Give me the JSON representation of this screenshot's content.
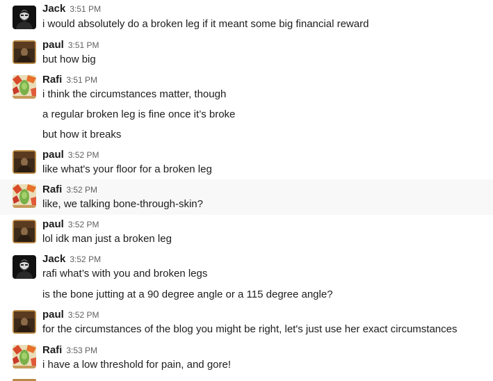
{
  "messages": [
    {
      "author": "Jack",
      "avatar": "jack",
      "time": "3:51 PM",
      "lines": [
        "i would absolutely do a broken leg if it meant some big financial reward"
      ]
    },
    {
      "author": "paul",
      "avatar": "paul",
      "time": "3:51 PM",
      "lines": [
        "but how big"
      ]
    },
    {
      "author": "Rafi",
      "avatar": "rafi",
      "time": "3:51 PM",
      "lines": [
        "i think the circumstances matter, though",
        "a regular broken leg is fine once it’s broke",
        "but how it breaks"
      ]
    },
    {
      "author": "paul",
      "avatar": "paul",
      "time": "3:52 PM",
      "lines": [
        "like what's your floor for a broken leg"
      ]
    },
    {
      "author": "Rafi",
      "avatar": "rafi",
      "time": "3:52 PM",
      "lines": [
        "like, we talking bone-through-skin?"
      ]
    },
    {
      "author": "paul",
      "avatar": "paul",
      "time": "3:52 PM",
      "lines": [
        "lol idk man just a broken leg"
      ]
    },
    {
      "author": "Jack",
      "avatar": "jack",
      "time": "3:52 PM",
      "lines": [
        "rafi what’s with you and broken legs",
        "is the bone jutting at a 90 degree angle or a 115 degree angle?"
      ]
    },
    {
      "author": "paul",
      "avatar": "paul",
      "time": "3:52 PM",
      "lines": [
        "for the circumstances of the blog you might be right, let's just use her exact circumstances"
      ]
    },
    {
      "author": "Rafi",
      "avatar": "rafi",
      "time": "3:53 PM",
      "lines": [
        "i have a low threshold for pain, and gore!"
      ]
    }
  ],
  "colors": {
    "text": "#1d1c1d",
    "timestamp": "#616061",
    "hover_bg": "#f8f8f8"
  }
}
